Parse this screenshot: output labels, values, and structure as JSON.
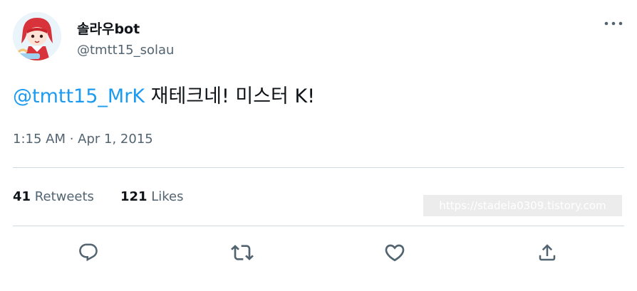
{
  "author": {
    "display_name": "솔라우bot",
    "handle": "@tmtt15_solau"
  },
  "tweet": {
    "mention": "@tmtt15_MrK",
    "body": " 재테크네! 미스터 K!",
    "timestamp": "1:15 AM · Apr 1, 2015"
  },
  "stats": {
    "retweets_count": "41",
    "retweets_label": "Retweets",
    "likes_count": "121",
    "likes_label": "Likes"
  },
  "watermark": "https://stadela0309.tistory.com",
  "icons": {
    "more": "more-horizontal-icon",
    "reply": "reply-icon",
    "retweet": "retweet-icon",
    "like": "heart-icon",
    "share": "share-icon"
  },
  "colors": {
    "accent": "#1d9bf0",
    "text": "#0f1419",
    "secondary": "#536471",
    "divider": "#cfd9de"
  }
}
